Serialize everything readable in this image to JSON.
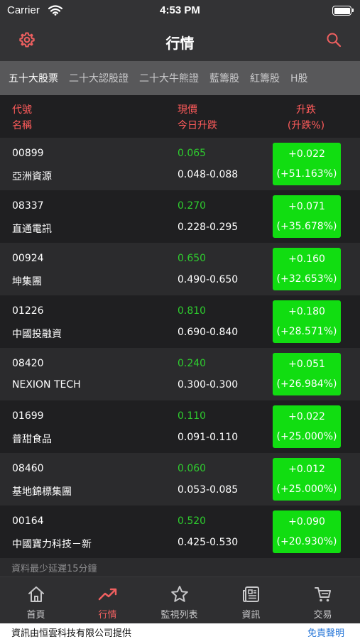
{
  "status_bar": {
    "carrier": "Carrier",
    "time": "4:53 PM"
  },
  "header": {
    "title": "行情",
    "left_icon": "gear-icon",
    "right_icon": "search-icon"
  },
  "tabs": [
    {
      "label": "五十大股票",
      "active": true
    },
    {
      "label": "二十大認股證",
      "active": false
    },
    {
      "label": "二十大牛熊證",
      "active": false
    },
    {
      "label": "藍籌股",
      "active": false
    },
    {
      "label": "紅籌股",
      "active": false
    },
    {
      "label": "H股",
      "active": false
    }
  ],
  "columns": {
    "code_label": "代號",
    "name_label": "名稱",
    "price_label": "現價",
    "range_label": "今日升跌",
    "change_label": "升跌",
    "change_pct_label": "(升跌%)"
  },
  "rows": [
    {
      "code": "00899",
      "name": "亞洲資源",
      "price": "0.065",
      "range": "0.048-0.088",
      "change": "+0.022",
      "change_pct": "(+51.163%)"
    },
    {
      "code": "08337",
      "name": "直通電訊",
      "price": "0.270",
      "range": "0.228-0.295",
      "change": "+0.071",
      "change_pct": "(+35.678%)"
    },
    {
      "code": "00924",
      "name": "坤集團",
      "price": "0.650",
      "range": "0.490-0.650",
      "change": "+0.160",
      "change_pct": "(+32.653%)"
    },
    {
      "code": "01226",
      "name": "中國投融資",
      "price": "0.810",
      "range": "0.690-0.840",
      "change": "+0.180",
      "change_pct": "(+28.571%)"
    },
    {
      "code": "08420",
      "name": "NEXION TECH",
      "price": "0.240",
      "range": "0.300-0.300",
      "change": "+0.051",
      "change_pct": "(+26.984%)"
    },
    {
      "code": "01699",
      "name": "普甜食品",
      "price": "0.110",
      "range": "0.091-0.110",
      "change": "+0.022",
      "change_pct": "(+25.000%)"
    },
    {
      "code": "08460",
      "name": "基地錦標集團",
      "price": "0.060",
      "range": "0.053-0.085",
      "change": "+0.012",
      "change_pct": "(+25.000%)"
    },
    {
      "code": "00164",
      "name": "中國寶力科技－新",
      "price": "0.520",
      "range": "0.425-0.530",
      "change": "+0.090",
      "change_pct": "(+20.930%)"
    }
  ],
  "delay_notice": "資料最少延遲15分鐘",
  "tab_bar": [
    {
      "label": "首頁",
      "icon": "home-icon",
      "active": false
    },
    {
      "label": "行情",
      "icon": "trend-up-icon",
      "active": true
    },
    {
      "label": "監視列表",
      "icon": "star-icon",
      "active": false
    },
    {
      "label": "資訊",
      "icon": "news-icon",
      "active": false
    },
    {
      "label": "交易",
      "icon": "cart-icon",
      "active": false
    }
  ],
  "footer": {
    "provider": "資訊由恒雲科技有限公司提供",
    "disclaimer": "免責聲明"
  },
  "colors": {
    "accent_red": "#f06060",
    "price_green": "#2ecc2e",
    "change_box_green": "#11dd11",
    "row_even": "#2b2b2d",
    "row_odd": "#1f1f21",
    "link_blue": "#2a78d8"
  }
}
